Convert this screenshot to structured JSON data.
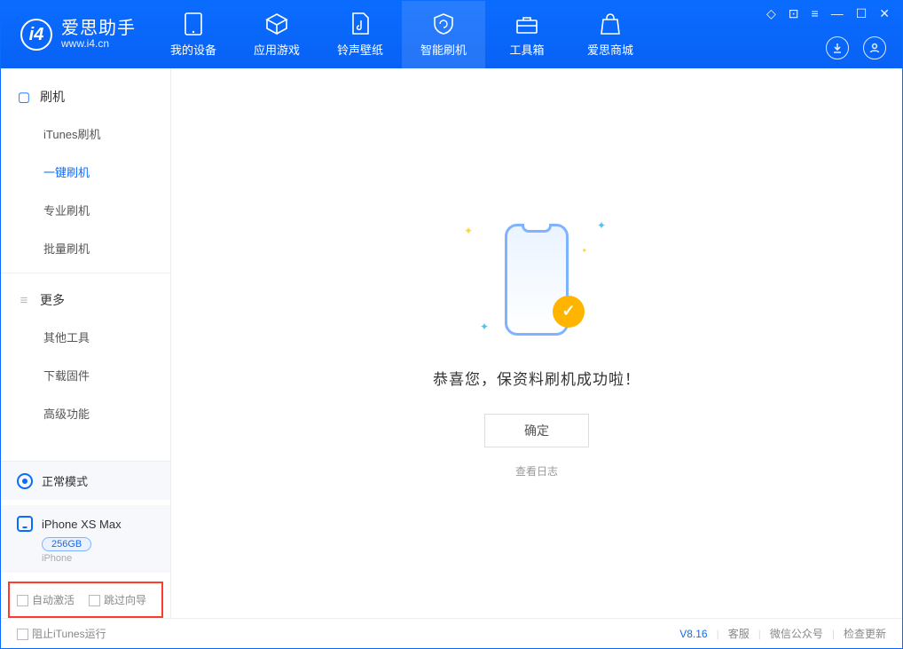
{
  "app": {
    "name_cn": "爱思助手",
    "name_en": "www.i4.cn"
  },
  "nav": [
    {
      "label": "我的设备"
    },
    {
      "label": "应用游戏"
    },
    {
      "label": "铃声壁纸"
    },
    {
      "label": "智能刷机"
    },
    {
      "label": "工具箱"
    },
    {
      "label": "爱思商城"
    }
  ],
  "sidebar": {
    "group1": {
      "title": "刷机",
      "items": [
        "iTunes刷机",
        "一键刷机",
        "专业刷机",
        "批量刷机"
      ]
    },
    "group2": {
      "title": "更多",
      "items": [
        "其他工具",
        "下载固件",
        "高级功能"
      ]
    },
    "status": "正常模式",
    "device": {
      "name": "iPhone XS Max",
      "storage": "256GB",
      "type": "iPhone"
    },
    "chk1": "自动激活",
    "chk2": "跳过向导"
  },
  "main": {
    "success": "恭喜您，保资料刷机成功啦！",
    "ok": "确定",
    "log": "查看日志"
  },
  "footer": {
    "block_itunes": "阻止iTunes运行",
    "version": "V8.16",
    "links": [
      "客服",
      "微信公众号",
      "检查更新"
    ]
  }
}
